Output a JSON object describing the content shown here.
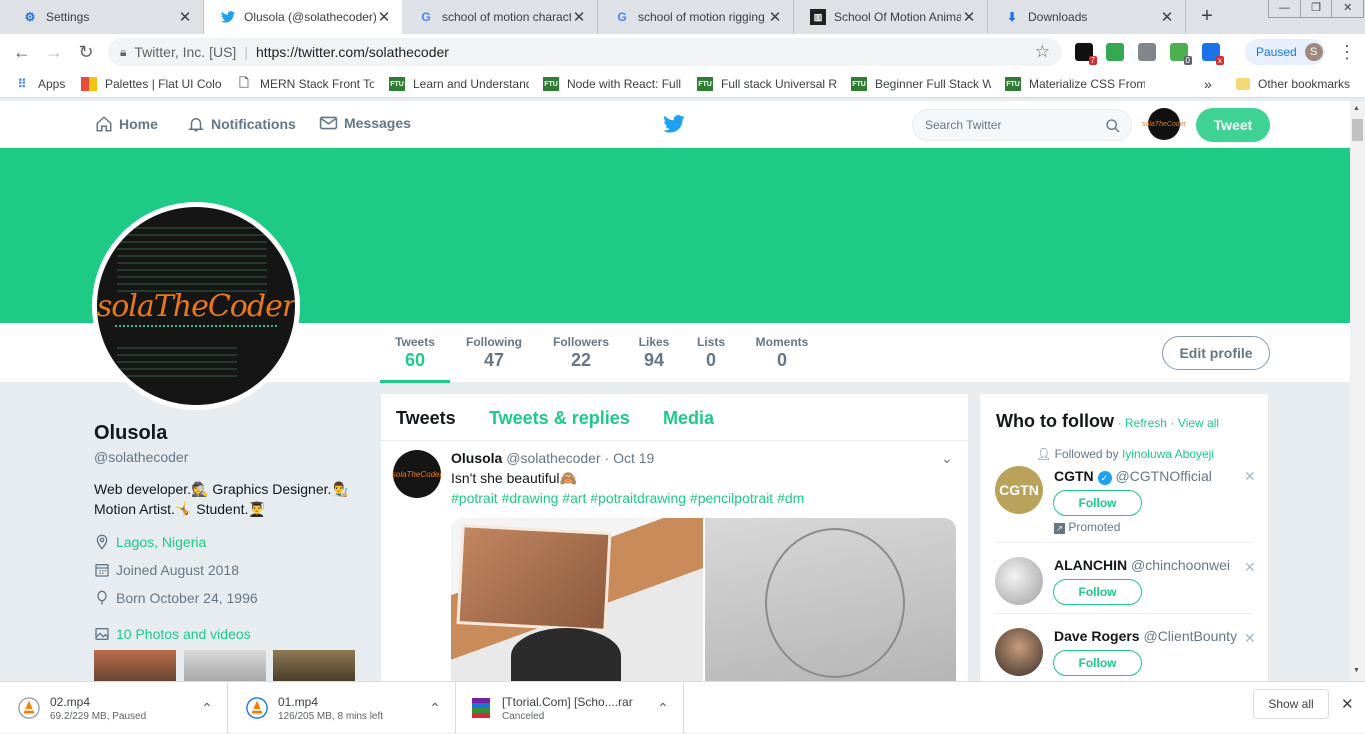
{
  "browser": {
    "tabs": [
      {
        "title": "Settings",
        "icon": "gear-icon"
      },
      {
        "title": "Olusola (@solathecoder)",
        "icon": "twitter-icon",
        "active": true
      },
      {
        "title": "school of motion charact",
        "icon": "google-icon"
      },
      {
        "title": "school of motion rigging",
        "icon": "google-icon"
      },
      {
        "title": "School Of Motion Anima",
        "icon": "site-icon"
      },
      {
        "title": "Downloads",
        "icon": "download-icon"
      }
    ],
    "new_tab_label": "+",
    "address": {
      "org": "Twitter, Inc. [US]",
      "url": "https://twitter.com/solathecoder"
    },
    "extension_badges": [
      "7",
      "0",
      "x"
    ],
    "profile_status": "Paused",
    "profile_initial": "S",
    "bookmarks": [
      {
        "label": "Apps",
        "icon": "apps-grid-icon"
      },
      {
        "label": "Palettes | Flat UI Colo",
        "icon": "palette-icon"
      },
      {
        "label": "MERN Stack Front To",
        "icon": "page-icon"
      },
      {
        "label": "Learn and Understand",
        "icon": "ftu-icon",
        "icon_text": "FTU"
      },
      {
        "label": "Node with React: Full",
        "icon": "ftu-icon",
        "icon_text": "FTU"
      },
      {
        "label": "Full stack Universal R",
        "icon": "ftu-icon",
        "icon_text": "FTU"
      },
      {
        "label": "Beginner Full Stack W",
        "icon": "ftu-icon",
        "icon_text": "FTU"
      },
      {
        "label": "Materialize CSS From",
        "icon": "ftu-icon",
        "icon_text": "FTU"
      }
    ],
    "bookmarks_overflow": "»",
    "other_bookmarks": "Other bookmarks"
  },
  "twitter": {
    "nav": {
      "home": "Home",
      "notifications": "Notifications",
      "messages": "Messages"
    },
    "search_placeholder": "Search Twitter",
    "tweet_button": "Tweet",
    "brand_color": "#1dca86",
    "avatar_text": "solaTheCoder",
    "profile": {
      "name": "Olusola",
      "handle": "@solathecoder",
      "bio_line1": "Web developer.🕵️ Graphics Designer.👨‍🎨",
      "bio_line2": "Motion Artist.🤸 Student.👨‍🎓",
      "location": "Lagos, Nigeria",
      "joined": "Joined August 2018",
      "born": "Born October 24, 1996",
      "photos": "10 Photos and videos"
    },
    "stats": [
      {
        "label": "Tweets",
        "value": "60"
      },
      {
        "label": "Following",
        "value": "47"
      },
      {
        "label": "Followers",
        "value": "22"
      },
      {
        "label": "Likes",
        "value": "94"
      },
      {
        "label": "Lists",
        "value": "0"
      },
      {
        "label": "Moments",
        "value": "0"
      }
    ],
    "edit_profile": "Edit profile",
    "timeline_tabs": [
      "Tweets",
      "Tweets & replies",
      "Media"
    ],
    "tweet": {
      "name": "Olusola",
      "handle": "@solathecoder",
      "date": "· Oct 19",
      "text": "Isn't she beautiful🙈",
      "hashtags": "#potrait #drawing #art #potraitdrawing #pencilpotrait #dm"
    },
    "who_to_follow": {
      "title": "Who to follow",
      "refresh": "· Refresh",
      "view_all": "· View all",
      "suggestions": [
        {
          "context_prefix": "Followed by",
          "context_name": "Iyinoluwa Aboyeji",
          "name": "CGTN",
          "handle": "@CGTNOfficial",
          "avatar_text": "CGTN",
          "verified": true,
          "follow": "Follow",
          "promoted": "Promoted"
        },
        {
          "name": "ALANCHIN",
          "handle": "@chinchoonwei",
          "follow": "Follow"
        },
        {
          "name": "Dave Rogers",
          "handle": "@ClientBounty",
          "follow": "Follow"
        }
      ]
    }
  },
  "downloads": {
    "items": [
      {
        "name": "02.mp4",
        "status": "69.2/229 MB, Paused",
        "icon": "vlc-icon"
      },
      {
        "name": "01.mp4",
        "status": "126/205 MB, 8 mins left",
        "icon": "vlc-icon"
      },
      {
        "name": "[Ttorial.Com] [Scho....rar",
        "status": "Canceled",
        "icon": "rar-icon"
      }
    ],
    "show_all": "Show all"
  }
}
